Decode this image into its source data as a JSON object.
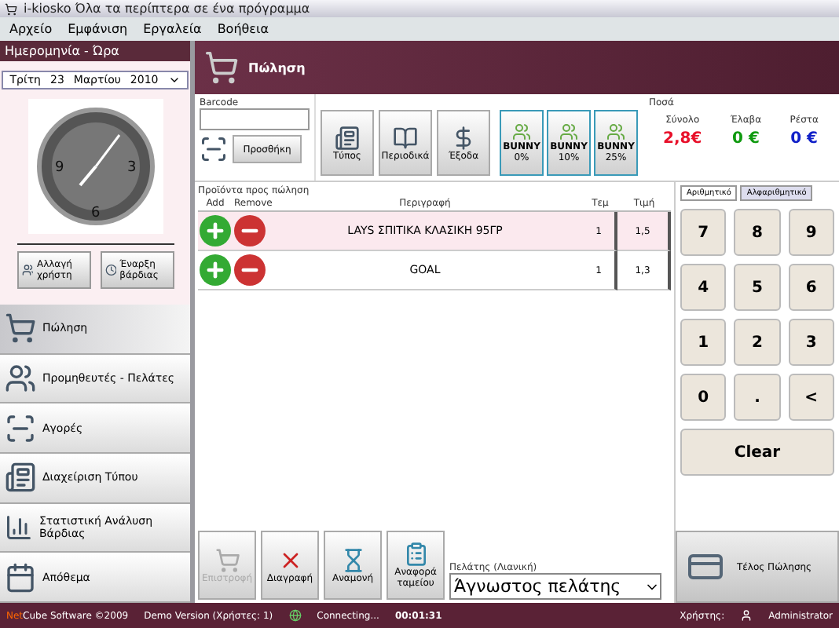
{
  "window": {
    "title": "i-kiosko Όλα τα περίπτερα σε ένα πρόγραμμα"
  },
  "menu": [
    "Αρχείο",
    "Εμφάνιση",
    "Εργαλεία",
    "Βοήθεια"
  ],
  "sidebar": {
    "header": "Ημερομηνία - Ώρα",
    "date": {
      "weekday": "Τρίτη",
      "day": "23",
      "month": "Μαρτίου",
      "year": "2010"
    },
    "clock_numbers": [
      "9",
      "3",
      "6"
    ],
    "actions": [
      {
        "label": "Αλλαγή χρήστη",
        "kind": "users"
      },
      {
        "label": "Έναρξη βάρδιας",
        "kind": "clock"
      }
    ],
    "items": [
      {
        "label": "Πώληση",
        "kind": "cart",
        "selected": true
      },
      {
        "label": "Προμηθευτές - Πελάτες",
        "kind": "people",
        "selected": false
      },
      {
        "label": "Αγορές",
        "kind": "scanner",
        "selected": false
      },
      {
        "label": "Διαχείριση Τύπου",
        "kind": "press",
        "selected": false
      },
      {
        "label": "Στατιστική  Ανάλυση  Βάρδιας",
        "kind": "chart",
        "selected": false
      },
      {
        "label": "Απόθεμα",
        "kind": "calendar",
        "selected": false
      }
    ]
  },
  "banner": {
    "title": "Πώληση"
  },
  "barcode": {
    "label": "Barcode",
    "add_button": "Προσθήκη"
  },
  "categories": [
    {
      "label": "Τύπος",
      "kind": "press"
    },
    {
      "label": "Περιοδικά",
      "kind": "magazine"
    },
    {
      "label": "Έξοδα",
      "kind": "money"
    }
  ],
  "discounts": [
    {
      "label": "BUNNY",
      "rate": "0%"
    },
    {
      "label": "BUNNY",
      "rate": "10%"
    },
    {
      "label": "BUNNY",
      "rate": "25%"
    }
  ],
  "totals": {
    "title": "Ποσά",
    "items": [
      {
        "label": "Σύνολο",
        "value": "2,8€",
        "color": "#e8102a"
      },
      {
        "label": "Έλαβα",
        "value": "0 €",
        "color": "#109a10"
      },
      {
        "label": "Ρέστα",
        "value": "0 €",
        "color": "#1020c8"
      }
    ]
  },
  "table": {
    "title": "Προϊόντα προς πώληση",
    "columns": [
      "Add",
      "Remove",
      "Περιγραφή",
      "Τεμ",
      "Τιμή"
    ],
    "rows": [
      {
        "description": "LAYS ΣΠΙΤΙΚΑ ΚΛΑΣΙΚΗ 95ΓΡ",
        "qty": "1",
        "price": "1,5",
        "selected": true
      },
      {
        "description": "GOAL",
        "qty": "1",
        "price": "1,3",
        "selected": false
      }
    ]
  },
  "keypad": {
    "tabs": [
      {
        "label": "Αριθμητικό",
        "selected": true
      },
      {
        "label": "Αλφαριθμητικό",
        "selected": false
      }
    ],
    "keys": [
      "7",
      "8",
      "9",
      "4",
      "5",
      "6",
      "1",
      "2",
      "3",
      "0",
      ".",
      "<"
    ],
    "clear": "Clear"
  },
  "actions": [
    {
      "label": "Επιστροφή",
      "kind": "cart",
      "disabled": true
    },
    {
      "label": "Διαγραφή",
      "kind": "delete",
      "disabled": false
    },
    {
      "label": "Αναμονή",
      "kind": "wait",
      "disabled": false
    },
    {
      "label": "Αναφορά ταμείου",
      "kind": "report",
      "disabled": false
    }
  ],
  "customer": {
    "label": "Πελάτης (Λιανική)",
    "value": "Άγνωστος πελάτης"
  },
  "finish_button": "Τέλος Πώλησης",
  "status_bar": {
    "brand_a": "Net",
    "brand_b": "Cube Software ©2009",
    "version": "Demo Version (Χρήστες: 1)",
    "connection": "Connecting...",
    "timer": "00:01:31",
    "user_label": "Χρήστης:",
    "user": "Administrator"
  }
}
